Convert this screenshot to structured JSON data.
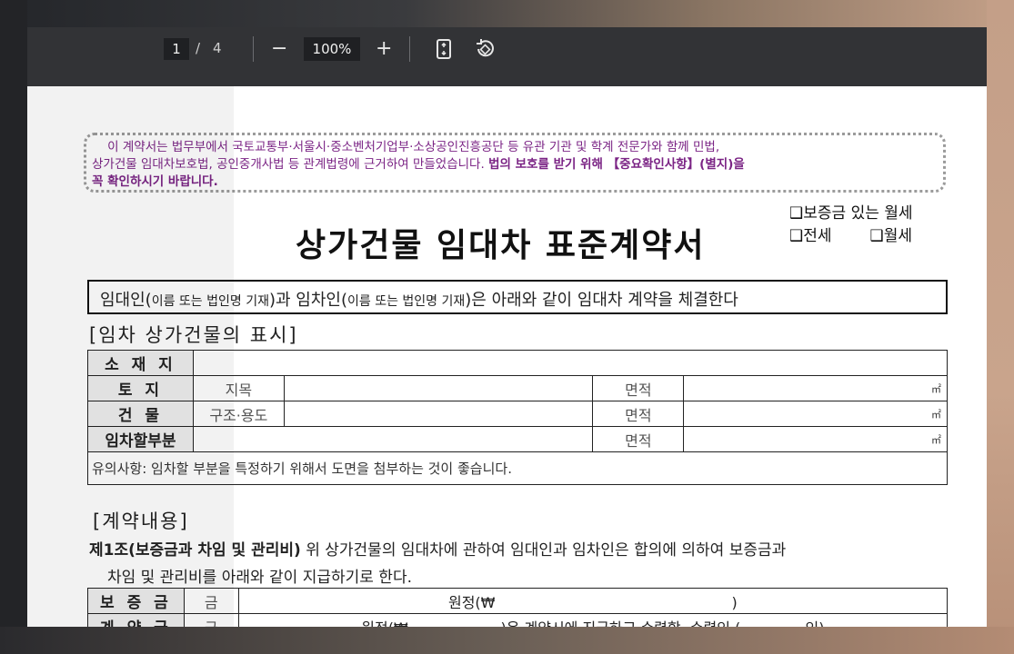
{
  "toolbar": {
    "current_page": "1",
    "page_sep": "/",
    "total_pages": "4",
    "zoom_out": "−",
    "zoom_level": "100%",
    "zoom_in": "+"
  },
  "notice": {
    "line1": "이 계약서는 법무부에서 국토교통부·서울시·중소벤처기업부·소상공인진흥공단 등 유관 기관 및 학계 전문가와 함께 민법,",
    "line2": "상가건물 임대차보호법, 공인중개사법 등 관계법령에 근거하여 만들었습니다.",
    "line2_bold": "법의 보호를 받기 위해 【중요확인사항】(별지)을",
    "line3_bold": "꼭 확인하시기 바랍니다."
  },
  "options": {
    "monthly_deposit": "❑보증금 있는 월세",
    "jeonse": "❑전세",
    "monthly": "❑월세"
  },
  "title": "상가건물 임대차 표준계약서",
  "intro": {
    "a": "임대인(",
    "a_small": "이름 또는 법인명 기재",
    "b": ")과 임차인(",
    "b_small": "이름 또는 법인명 기재",
    "c": ")은 아래와 같이 임대차 계약을 체결한다"
  },
  "section1": "[임차 상가건물의 표시]",
  "property_table": {
    "location": "소 재 지",
    "land": "토 지",
    "land_category": "지목",
    "building": "건 물",
    "building_use": "구조·용도",
    "leased_part": "임차할부분",
    "area": "면적",
    "unit": "㎡",
    "note": "유의사항: 임차할 부분을 특정하기 위해서 도면을 첨부하는 것이 좋습니다."
  },
  "section2": "[계약내용]",
  "clause1": {
    "heading": "제1조(보증금과 차임 및 관리비)",
    "text1": "위 상가건물의 임대차에 관하여 임대인과 임차인은 합의에 의하여 보증금과",
    "text2": "차임 및 관리비를 아래와 같이 지급하기로 한다."
  },
  "payment_table": {
    "deposit": "보 증 금",
    "contract_fee": "계 약 금",
    "money_prefix": "금",
    "won": "원정(₩",
    "close": ")",
    "contract_text": "원정(₩                    )은 계약시에 지급하고 수령함. 수령인 (              인)"
  }
}
